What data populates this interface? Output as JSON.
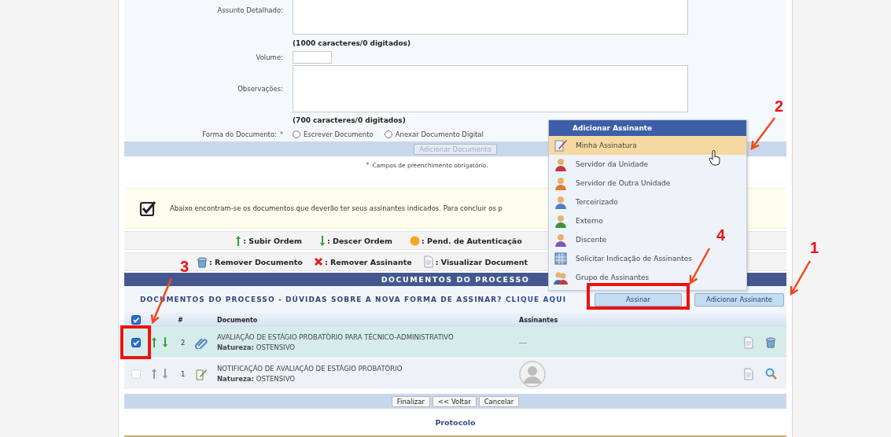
{
  "form": {
    "assunto_label": "Assunto Detalhado:",
    "assunto_counter": "(1000 caracteres/0 digitados)",
    "volume_label": "Volume:",
    "observacoes_label": "Observações:",
    "observacoes_counter": "(700 caracteres/0 digitados)",
    "forma_label": "Forma do Documento:",
    "required_mark": "*",
    "options": [
      {
        "label": "Escrever Documento",
        "selected": false
      },
      {
        "label": "Anexar Documento Digital",
        "selected": false
      }
    ],
    "add_button": {
      "label": "Adicionar Documento",
      "disabled": true
    },
    "required_note": "Campos de preenchimento obrigatório."
  },
  "notice": {
    "text": "Abaixo encontram-se os documentos que deverão ter seus assinantes indicados. Para concluir os p"
  },
  "legend": [
    [
      {
        "kind": "up",
        "label": ": Subir Ordem"
      },
      {
        "kind": "down",
        "label": ": Descer Ordem"
      },
      {
        "kind": "pending",
        "label": ": Pend. de Autenticação"
      }
    ],
    [
      {
        "kind": "remove",
        "label": ": Remover Documento"
      },
      {
        "kind": "cross",
        "label": ": Remover Assinante"
      },
      {
        "kind": "view",
        "label": ": Visualizar Document"
      }
    ]
  ],
  "section_title": "DOCUMENTOS DO PROCESSO",
  "subtitle": {
    "text": "DOCUMENTOS DO PROCESSO - DÚVIDAS SOBRE A NOVA FORMA DE ASSINAR?",
    "link": "CLIQUE AQUI"
  },
  "actions": [
    "Assinar",
    "Adicionar Assinante"
  ],
  "table": {
    "all_checked": true,
    "columns": [
      "#",
      "Documento",
      "Assinantes"
    ],
    "rows": [
      {
        "checked": true,
        "selected": true,
        "disabled": false,
        "number": "2",
        "kind": "attachment",
        "title": "AVALIAÇÃO DE ESTÁGIO PROBATÓRIO PARA TÉCNICO-ADMINISTRATIVO",
        "nature_label": "Natureza:",
        "nature": "OSTENSIVO",
        "signers": {
          "kind": "text",
          "text": "---"
        },
        "row_actions": [
          {
            "kind": "view"
          },
          {
            "kind": "remove"
          }
        ]
      },
      {
        "checked": false,
        "selected": false,
        "disabled": true,
        "number": "1",
        "kind": "written",
        "title": "NOTIFICAÇÃO DE AVALIAÇÃO DE ESTÁGIO PROBATÓRIO",
        "nature_label": "Natureza:",
        "nature": "OSTENSIVO",
        "signers": {
          "kind": "avatar"
        },
        "row_actions": [
          {
            "kind": "view"
          },
          {
            "kind": "search"
          }
        ]
      }
    ]
  },
  "footer_buttons": [
    "Finalizar",
    "<< Voltar",
    "Cancelar"
  ],
  "footer_link": "Protocolo",
  "menu": {
    "title": "Adicionar Assinante",
    "items": [
      {
        "label": "Minha Assinatura",
        "kind": "own",
        "selected": true
      },
      {
        "label": "Servidor da Unidade",
        "kind": "person",
        "selected": false
      },
      {
        "label": "Servidor de Outra Unidade",
        "kind": "person",
        "selected": false
      },
      {
        "label": "Terceirizado",
        "kind": "person",
        "selected": false
      },
      {
        "label": "Externo",
        "kind": "person",
        "selected": false
      },
      {
        "label": "Discente",
        "kind": "person",
        "selected": false
      },
      {
        "label": "Solicitar Indicação de Assinantes",
        "kind": "request",
        "selected": false
      },
      {
        "label": "Grupo de Assinantes",
        "kind": "group",
        "selected": false
      }
    ]
  },
  "annotations": [
    {
      "label": "1"
    },
    {
      "label": "2"
    },
    {
      "label": "3"
    },
    {
      "label": "4"
    }
  ]
}
